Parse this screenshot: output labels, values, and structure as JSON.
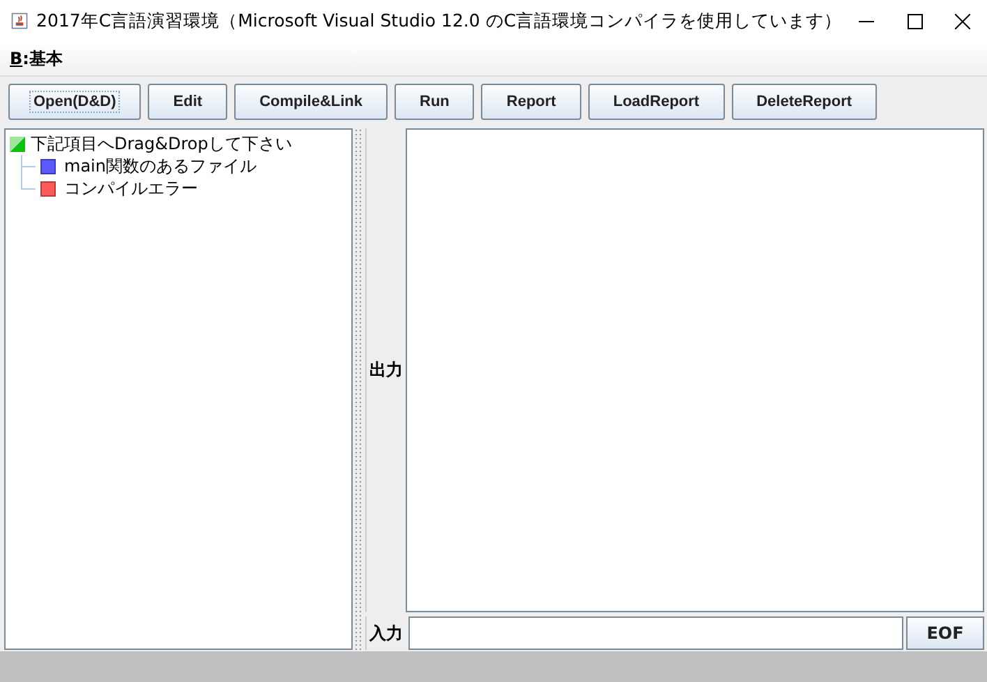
{
  "window": {
    "title": "2017年C言語演習環境（Microsoft Visual Studio 12.0 のC言語環境コンパイラを使用しています）"
  },
  "menu": [
    {
      "mnemonic": "B",
      "label": ":基本"
    }
  ],
  "toolbar": [
    {
      "label": "Open(D&D)",
      "focused": true
    },
    {
      "label": "Edit",
      "focused": false
    },
    {
      "label": "Compile&Link",
      "focused": false
    },
    {
      "label": "Run",
      "focused": false
    },
    {
      "label": "Report",
      "focused": false
    },
    {
      "label": "LoadReport",
      "focused": false
    },
    {
      "label": "DeleteReport",
      "focused": false
    }
  ],
  "tree": {
    "label": "下記項目へDrag&Dropして下さい",
    "color": "#10c010",
    "children": [
      {
        "label": "main関数のあるファイル",
        "color": "#5a5aff"
      },
      {
        "label": "コンパイルエラー",
        "color": "#ff5a5a"
      }
    ]
  },
  "output": {
    "label": "出力"
  },
  "input": {
    "label": "入力",
    "button": "EOF"
  }
}
